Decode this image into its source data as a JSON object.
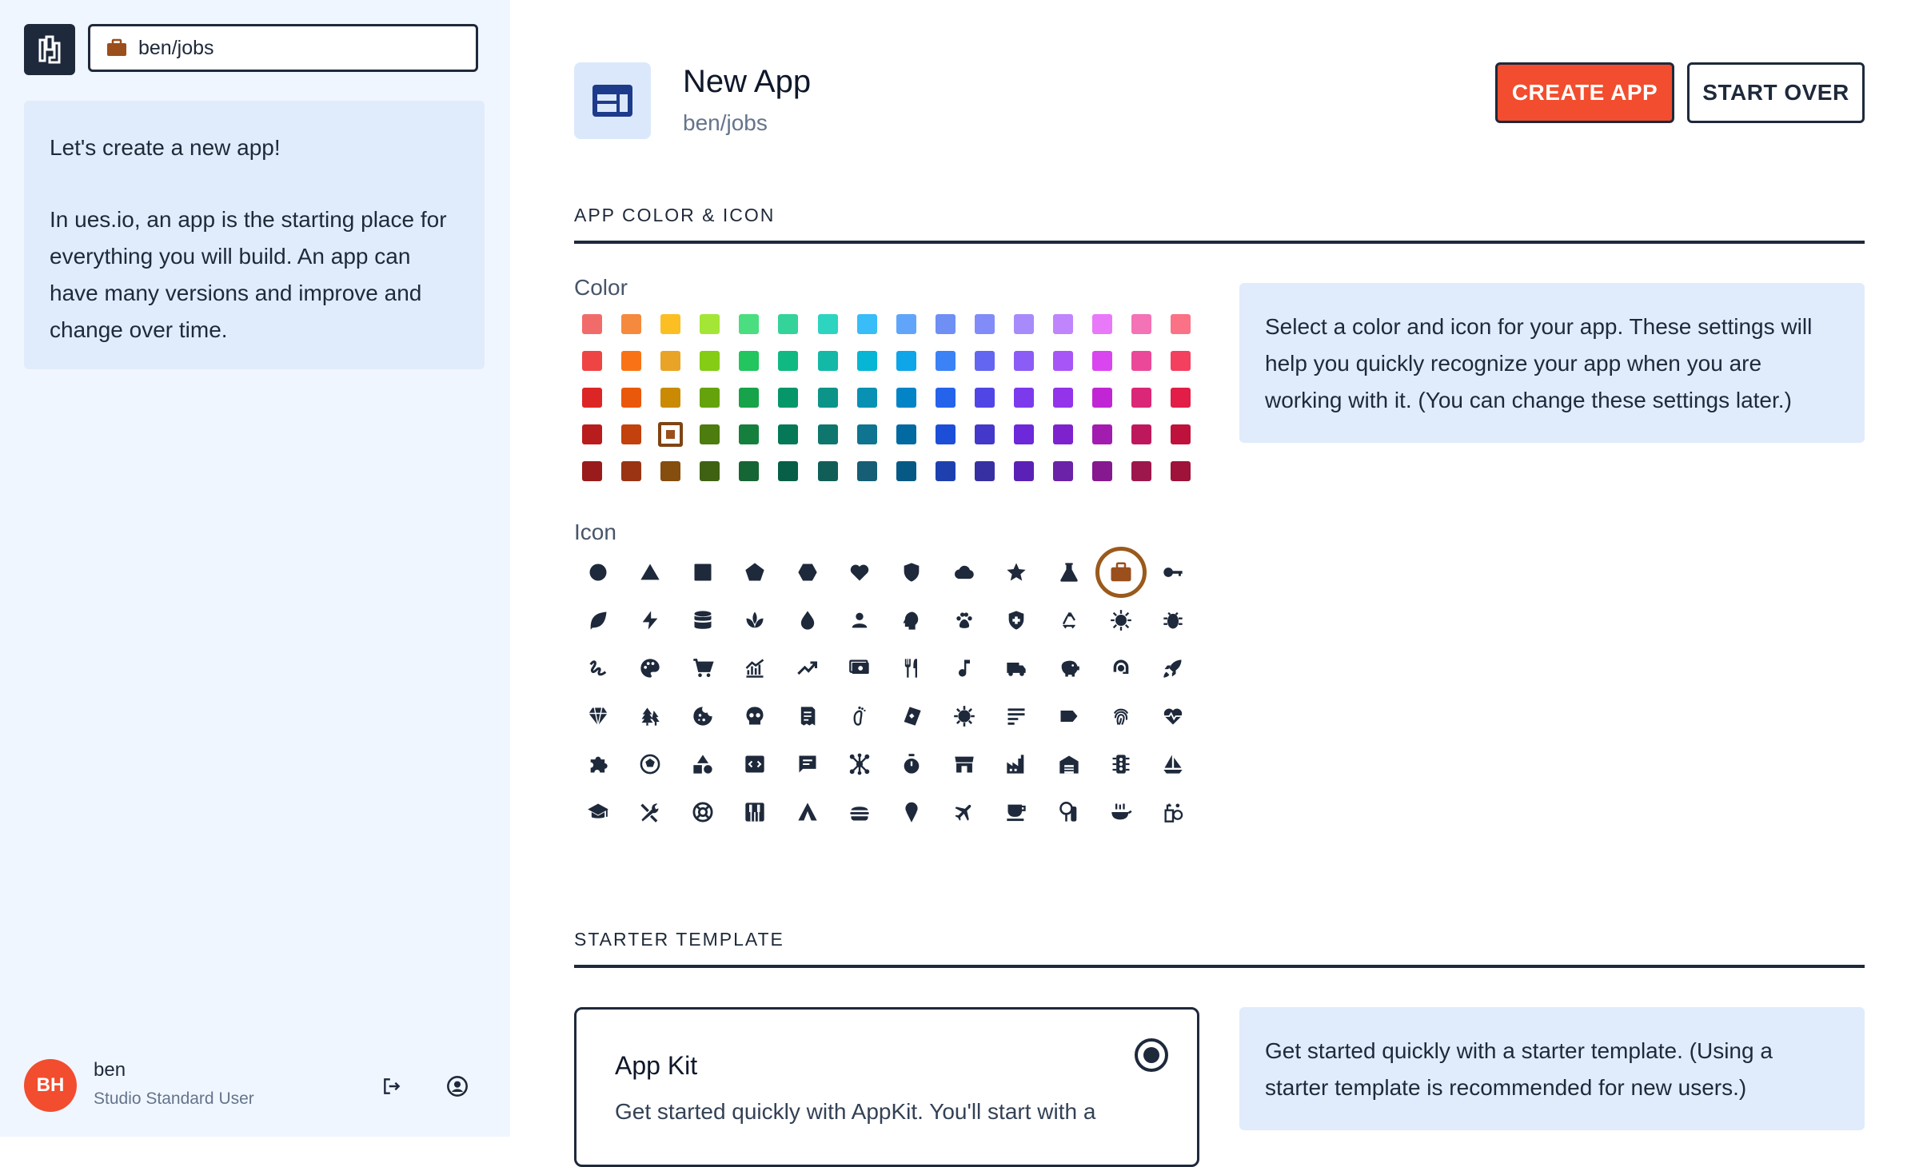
{
  "sidebar": {
    "app_path": "ben/jobs",
    "intro_title": "Let's create a new app!",
    "intro_body": "In ues.io, an app is the starting place for everything you will build. An app can have many versions and improve and change over time.",
    "user": {
      "initials": "BH",
      "name": "ben",
      "role": "Studio Standard User"
    }
  },
  "header": {
    "title": "New App",
    "subtitle": "ben/jobs",
    "create_label": "CREATE APP",
    "start_over_label": "START OVER"
  },
  "color_section": {
    "heading": "APP COLOR & ICON",
    "color_label": "Color",
    "icon_label": "Icon",
    "help": "Select a color and icon for your app. These settings will help you quickly recognize your app when you are working with it. (You can change these settings later.)",
    "selected_color": "#9a4f1c",
    "palette": [
      [
        "#f26b6b",
        "#f5893e",
        "#fbbf24",
        "#a3e635",
        "#4ade80",
        "#34d399",
        "#2dd4bf",
        "#38bdf8",
        "#60a5fa",
        "#6f8ff5",
        "#818cf8",
        "#a78bfa",
        "#c084fc",
        "#e879f9",
        "#f472b6",
        "#fb7185"
      ],
      [
        "#ef4444",
        "#f97316",
        "#e9a326",
        "#84cc16",
        "#22c55e",
        "#10b981",
        "#14b8a6",
        "#06b6d4",
        "#0ea5e9",
        "#3b82f6",
        "#6366f1",
        "#8b5cf6",
        "#a855f7",
        "#d946ef",
        "#ec4899",
        "#f43f5e"
      ],
      [
        "#dc2626",
        "#ea580c",
        "#ca8a04",
        "#65a30d",
        "#16a34a",
        "#059669",
        "#0d9488",
        "#0891b2",
        "#0284c7",
        "#2563eb",
        "#4f46e5",
        "#7c3aed",
        "#9333ea",
        "#c026d3",
        "#db2777",
        "#e11d48"
      ],
      [
        "#b91c1c",
        "#c2410c",
        "#9a4f1c",
        "#4d7c0f",
        "#15803d",
        "#047857",
        "#0f766e",
        "#0e7490",
        "#0369a1",
        "#1d4ed8",
        "#4338ca",
        "#6d28d9",
        "#7e22ce",
        "#a21caf",
        "#be185d",
        "#be123c"
      ],
      [
        "#991b1b",
        "#9a3412",
        "#854d0e",
        "#3f6212",
        "#166534",
        "#065f46",
        "#115e59",
        "#155e75",
        "#075985",
        "#1e40af",
        "#3730a3",
        "#5b21b6",
        "#6b21a8",
        "#86198f",
        "#9d174d",
        "#9f1239"
      ]
    ],
    "selected_swatch": [
      3,
      2
    ],
    "selected_icon_index": 10,
    "icons": [
      "circle-icon",
      "triangle-icon",
      "square-icon",
      "pentagon-icon",
      "hexagon-icon",
      "heart-icon",
      "shield-icon",
      "cloud-icon",
      "star-icon",
      "flask-icon",
      "briefcase-icon",
      "key-icon",
      "leaf-icon",
      "bolt-icon",
      "database-icon",
      "spa-icon",
      "droplet-icon",
      "person-icon",
      "psychology-icon",
      "paw-icon",
      "health-shield-icon",
      "recycle-icon",
      "virus-icon",
      "bug-icon",
      "gesture-icon",
      "palette-icon",
      "cart-icon",
      "chart-icon",
      "trending-icon",
      "payments-icon",
      "restaurant-icon",
      "music-note-icon",
      "truck-icon",
      "savings-icon",
      "support-agent-icon",
      "rocket-icon",
      "diamond-icon",
      "forest-icon",
      "cookie-icon",
      "skull-icon",
      "receipt-icon",
      "footprint-icon",
      "playing-card-icon",
      "coronavirus-icon",
      "notes-icon",
      "label-icon",
      "fingerprint-icon",
      "heart-monitor-icon",
      "puzzle-icon",
      "sports-ball-icon",
      "category-icon",
      "code-icon",
      "chat-icon",
      "hub-icon",
      "timer-icon",
      "storefront-icon",
      "factory-icon",
      "warehouse-icon",
      "traffic-icon",
      "sailboat-icon",
      "graduation-cap-icon",
      "tools-icon",
      "life-ring-icon",
      "piano-icon",
      "tent-icon",
      "burger-icon",
      "icecream-icon",
      "airplane-icon",
      "coffee-icon",
      "room-service-icon",
      "cooking-icon",
      "soap-icon"
    ]
  },
  "template_section": {
    "heading": "STARTER TEMPLATE",
    "card_title": "App Kit",
    "card_desc": "Get started quickly with AppKit. You'll start with a",
    "help": "Get started quickly with a starter template. (Using a starter template is recommended for new users.)"
  },
  "colors": {
    "accent": "#f24d2e",
    "dark": "#1e293b",
    "panel": "#e0ecfc",
    "sidebar_bg": "#f0f6ff",
    "selected": "#9a4f1c"
  }
}
